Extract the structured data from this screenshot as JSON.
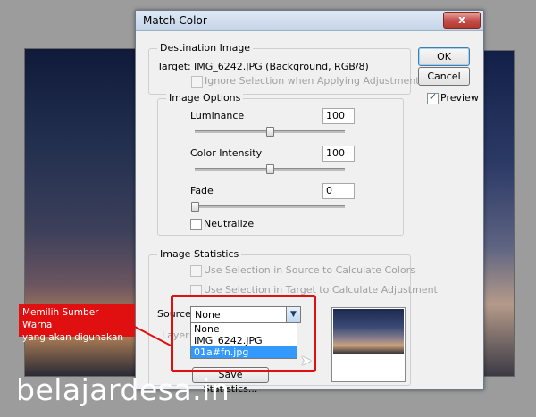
{
  "window": {
    "title": "Match Color",
    "close_label": "x"
  },
  "buttons": {
    "ok": "OK",
    "cancel": "Cancel"
  },
  "preview": {
    "label": "Preview",
    "checked": true
  },
  "destination": {
    "legend": "Destination Image",
    "target_label": "Target:",
    "target_value": "IMG_6242.JPG (Background, RGB/8)",
    "ignore_selection": "Ignore Selection when Applying Adjustment"
  },
  "image_options": {
    "legend": "Image Options",
    "luminance": {
      "label": "Luminance",
      "value": "100"
    },
    "color_intensity": {
      "label": "Color Intensity",
      "value": "100"
    },
    "fade": {
      "label": "Fade",
      "value": "0"
    },
    "neutralize": "Neutralize"
  },
  "image_statistics": {
    "legend": "Image Statistics",
    "use_sel_source": "Use Selection in Source to Calculate Colors",
    "use_sel_target": "Use Selection in Target to Calculate Adjustment",
    "source_label": "Source:",
    "source_value": "None",
    "layer_label": "Layer:",
    "source_options": [
      "None",
      "IMG_6242.JPG",
      "01a#fn.jpg"
    ],
    "save_statistics": "Save Statistics..."
  },
  "annotation": {
    "callout_line1": "Memilih Sumber Warna",
    "callout_line2": "yang akan digunakan"
  },
  "watermark": "belajardesa.in"
}
